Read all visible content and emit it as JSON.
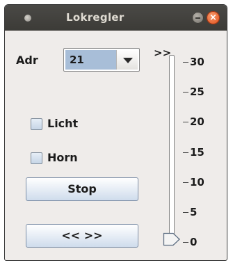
{
  "window": {
    "title": "Lokregler"
  },
  "controls": {
    "address_label": "Adr",
    "address_value": "21",
    "direction_label": ">>",
    "light_label": "Licht",
    "light_checked": false,
    "horn_label": "Horn",
    "horn_checked": false,
    "stop_label": "Stop",
    "reverse_label": "<< >>"
  },
  "speed_slider": {
    "value": 0,
    "min": 0,
    "max": 30,
    "tick_labels": [
      "30",
      "25",
      "20",
      "15",
      "10",
      "5",
      "0"
    ]
  },
  "icons": {
    "window_menu": "app-menu-dot-icon",
    "minimize": "minimize-icon",
    "close": "close-icon",
    "dropdown": "chevron-down-icon",
    "thumb": "slider-thumb-icon"
  },
  "colors": {
    "titlebar": "#3c3b37",
    "close_button": "#df4a16",
    "selection": "#a8bed8",
    "window_bg": "#efecea"
  }
}
